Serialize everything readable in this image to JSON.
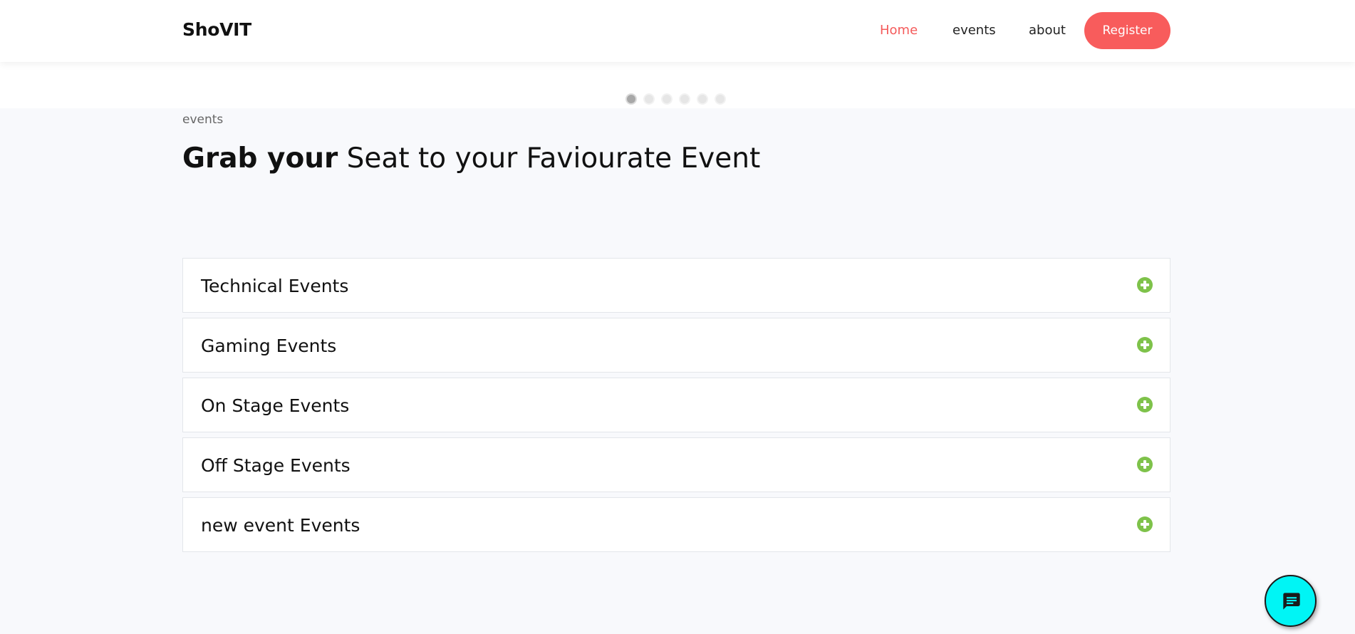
{
  "nav": {
    "brand": "ShoVIT",
    "links": [
      "Home",
      "events",
      "about"
    ],
    "register_label": "Register",
    "active_link": "Home",
    "accent_color": "#f85c5c"
  },
  "carousel": {
    "dot_count": 6,
    "active_index": 0
  },
  "section": {
    "tag": "events",
    "title_bold": "Grab your",
    "title_rest": " Seat to your Faviourate Event"
  },
  "accordion": {
    "items": [
      {
        "label": "Technical Events",
        "icon": "plus-circle-icon"
      },
      {
        "label": "Gaming Events",
        "icon": "plus-circle-icon"
      },
      {
        "label": "On Stage Events",
        "icon": "plus-circle-icon"
      },
      {
        "label": "Off Stage Events",
        "icon": "plus-circle-icon"
      },
      {
        "label": "new event Events",
        "icon": "plus-circle-icon"
      }
    ],
    "icon_color": "#7ec24a"
  },
  "chat": {
    "icon": "chat-icon",
    "color": "#00f5f5"
  }
}
